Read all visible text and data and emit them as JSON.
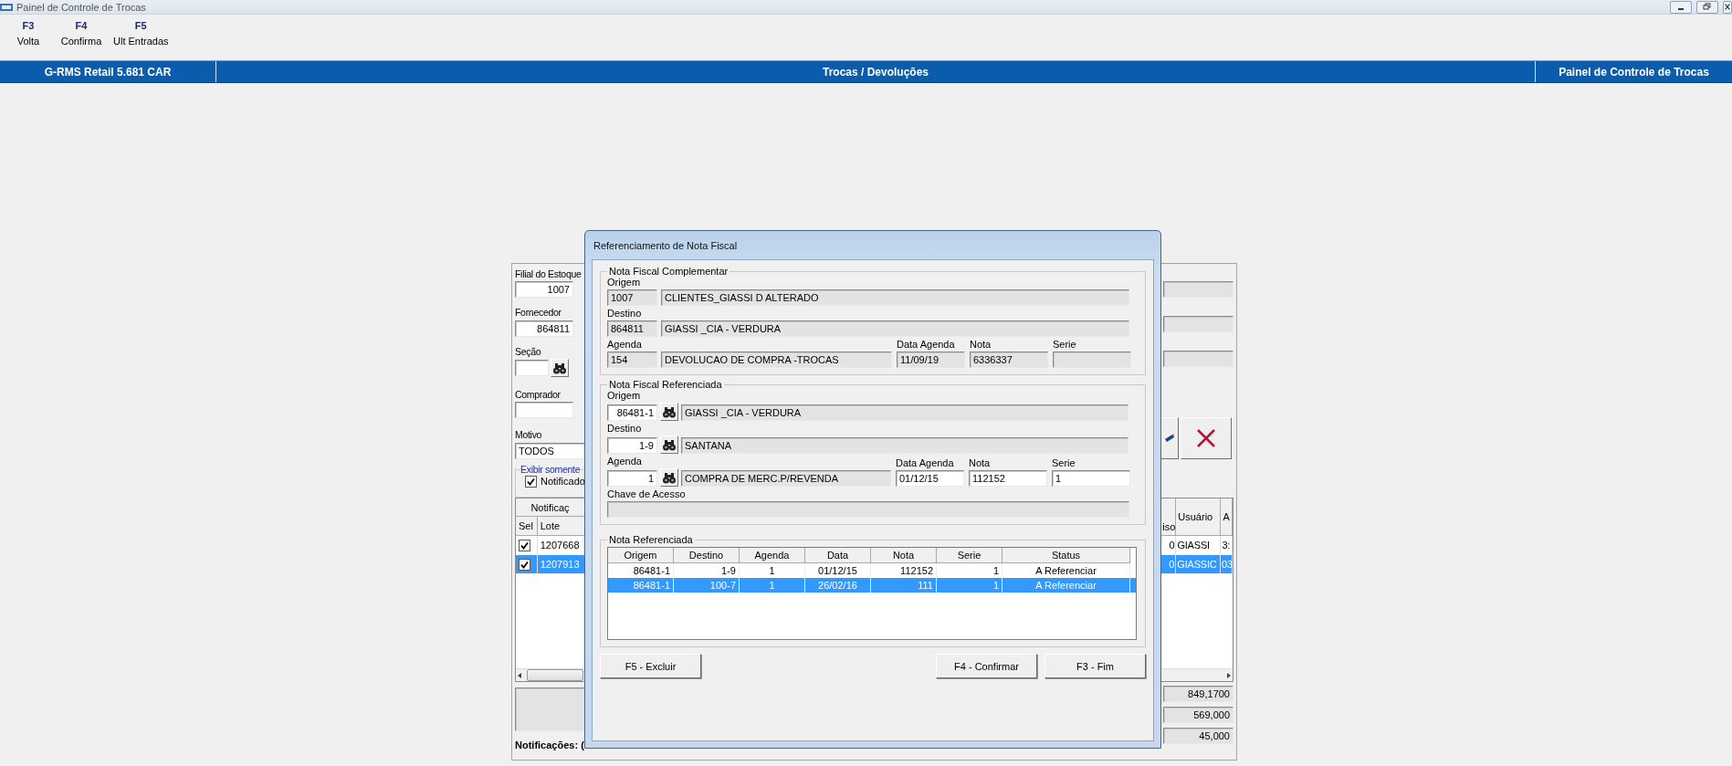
{
  "window": {
    "title": "Painel de Controle de Trocas"
  },
  "toolbar": [
    {
      "key": "F3",
      "label": "Volta"
    },
    {
      "key": "F4",
      "label": "Confirma"
    },
    {
      "key": "F5",
      "label": "Ult Entradas"
    }
  ],
  "header_bar": {
    "product": "G-RMS Retail 5.681 CAR",
    "module": "Trocas / Devoluções",
    "screen": "Painel de Controle de Trocas"
  },
  "panel": {
    "filters": [
      {
        "label": "Filial do Estoque",
        "value": "1007",
        "kind": "code"
      },
      {
        "label": "Fornecedor",
        "value": "864811",
        "kind": "code"
      },
      {
        "label": "Seção",
        "kind": "lookup"
      },
      {
        "label": "Comprador",
        "kind": "code"
      },
      {
        "label": "Motivo",
        "value": "TODOS",
        "kind": "select"
      }
    ],
    "filter_group": {
      "title": "Exibir somente",
      "option": {
        "label": "Notificado",
        "checked": true
      }
    },
    "table": {
      "group_header": "Notificaç",
      "columns_left": [
        "Sel",
        "Lote"
      ],
      "columns_right": [
        "iso",
        "Usuário",
        "A"
      ],
      "rows": [
        {
          "checked": true,
          "lote": "1207668",
          "aviso": "0",
          "usuario": "GIASSI",
          "column_a": "3:",
          "selected": false
        },
        {
          "checked": true,
          "lote": "1207913",
          "aviso": "0",
          "usuario": "GIASSIC",
          "column_a": "03",
          "selected": true
        }
      ]
    },
    "totals": [
      "849,1700",
      "569,000",
      "45,000"
    ],
    "footer_label": "Notificações: ("
  },
  "dialog": {
    "title": "Referenciamento de Nota Fiscal",
    "groups": [
      {
        "title": "Nota Fiscal Complementar",
        "editable": false,
        "origem": {
          "label": "Origem",
          "code": "1007",
          "name": "CLIENTES_GIASSI D ALTERADO"
        },
        "destino": {
          "label": "Destino",
          "code": "864811",
          "name": "GIASSI _CIA - VERDURA"
        },
        "agenda": {
          "label": "Agenda",
          "code": "154",
          "name": "DEVOLUCAO DE COMPRA -TROCAS"
        },
        "data_agenda": {
          "label": "Data Agenda",
          "value": "11/09/19"
        },
        "nota": {
          "label": "Nota",
          "value": "6336337"
        },
        "serie": {
          "label": "Serie"
        }
      },
      {
        "title": "Nota Fiscal Referenciada",
        "editable": true,
        "origem": {
          "label": "Origem",
          "code": "86481-1",
          "name": "GIASSI _CIA - VERDURA"
        },
        "destino": {
          "label": "Destino",
          "code": "1-9",
          "name": "SANTANA"
        },
        "agenda": {
          "label": "Agenda",
          "code": "1",
          "name": "COMPRA DE MERC.P/REVENDA"
        },
        "data_agenda": {
          "label": "Data Agenda",
          "value": "01/12/15"
        },
        "nota": {
          "label": "Nota",
          "value": "112152"
        },
        "serie": {
          "label": "Serie",
          "value": "1"
        },
        "chave_de_acesso": {
          "label": "Chave de Acesso"
        }
      }
    ],
    "list": {
      "title": "Nota Referenciada",
      "columns": [
        "Origem",
        "Destino",
        "Agenda",
        "Data",
        "Nota",
        "Serie",
        "Status"
      ],
      "rows": [
        {
          "cells": [
            "86481-1",
            "1-9",
            "1",
            "01/12/15",
            "112152",
            "1",
            "A Referenciar"
          ],
          "selected": false
        },
        {
          "cells": [
            "86481-1",
            "100-7",
            "1",
            "26/02/16",
            "111",
            "1",
            "A Referenciar"
          ],
          "selected": true
        }
      ]
    },
    "buttons": [
      "F5 - Excluir",
      "F4 - Confirmar",
      "F3 - Fim"
    ]
  }
}
